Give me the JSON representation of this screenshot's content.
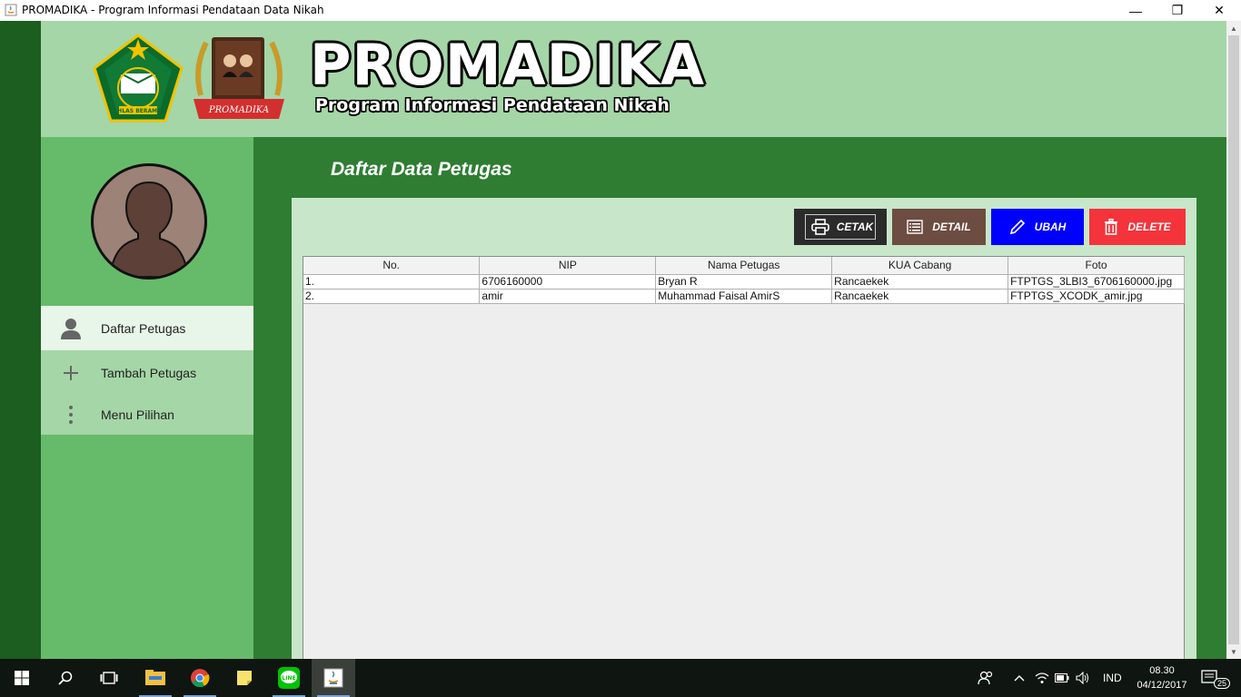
{
  "window": {
    "title": "PROMADIKA - Program Informasi Pendataan Data Nikah",
    "minimize": "—",
    "maximize": "❐",
    "close": "✕"
  },
  "header": {
    "brand_title": "PROMADIKA",
    "brand_subtitle": "Program Informasi Pendataan Nikah",
    "logo_kemenag_text": "IKHLAS BERAMAL",
    "logo_promadika_text": "PROMADIKA"
  },
  "sidebar": {
    "items": [
      {
        "label": "Daftar Petugas",
        "icon": "person-icon",
        "active": true
      },
      {
        "label": "Tambah Petugas",
        "icon": "plus-icon",
        "active": false
      },
      {
        "label": "Menu Pilihan",
        "icon": "more-vertical-icon",
        "active": false
      }
    ]
  },
  "main": {
    "title": "Daftar Data Petugas",
    "buttons": {
      "cetak": "CETAK",
      "detail": "DETAIL",
      "ubah": "UBAH",
      "delete": "DELETE"
    },
    "table": {
      "columns": [
        "No.",
        "NIP",
        "Nama Petugas",
        "KUA Cabang",
        "Foto"
      ],
      "rows": [
        [
          "1.",
          "6706160000",
          "Bryan R",
          "Rancaekek",
          "FTPTGS_3LBI3_6706160000.jpg"
        ],
        [
          "2.",
          "amir",
          "Muhammad Faisal AmirS",
          "Rancaekek",
          "FTPTGS_XCODK_amir.jpg"
        ]
      ]
    }
  },
  "taskbar": {
    "language": "IND",
    "time": "08.30",
    "date": "04/12/2017",
    "notification_count": "25"
  },
  "colors": {
    "header_bg": "#a5d6a7",
    "sidebar_bg": "#66bb6a",
    "main_bg": "#2e7d32",
    "panel_bg": "#c8e6c9",
    "btn_cetak": "#2b2b2b",
    "btn_detail": "#6d4c41",
    "btn_ubah": "#0000ff",
    "btn_delete": "#f4333b"
  }
}
